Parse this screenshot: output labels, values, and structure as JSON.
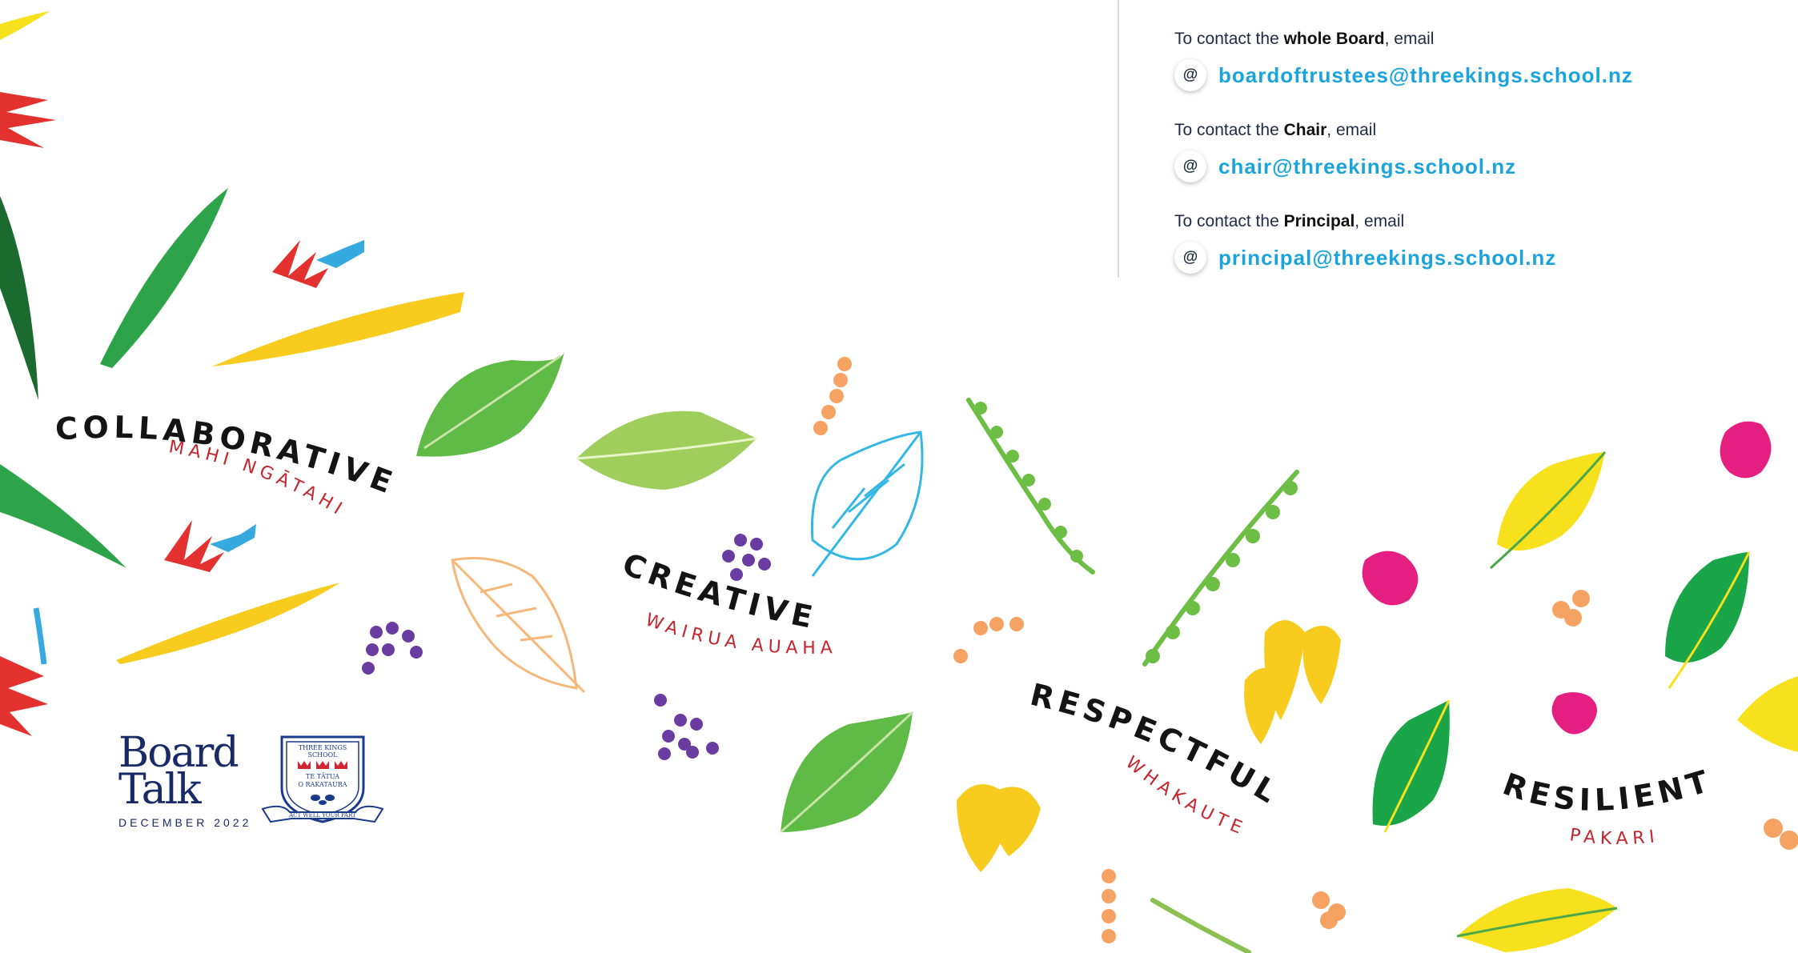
{
  "contact": {
    "blocks": [
      {
        "prefix": "To contact the ",
        "bold": "whole Board",
        "suffix": ", email",
        "email": "boardoftrustees@threekings.school.nz"
      },
      {
        "prefix": "To contact the ",
        "bold": "Chair",
        "suffix": ", email",
        "email": "chair@threekings.school.nz"
      },
      {
        "prefix": "To contact the ",
        "bold": "Principal",
        "suffix": ", email",
        "email": "principal@threekings.school.nz"
      }
    ],
    "at_symbol": "@"
  },
  "values": [
    {
      "word": "COLLABORATIVE",
      "maori": "MAHI NGĀTAHI"
    },
    {
      "word": "CREATIVE",
      "maori": "WAIRUA AUAHA"
    },
    {
      "word": "RESPECTFUL",
      "maori": "WHAKAUTE"
    },
    {
      "word": "RESILIENT",
      "maori": "PAKARI"
    }
  ],
  "brand": {
    "title_line1": "Board",
    "title_line2": "Talk",
    "date": "DECEMBER 2022"
  },
  "crest": {
    "line1": "THREE KINGS",
    "line2": "SCHOOL",
    "line3": "TE TĀTUA",
    "line4": "O RAKATAURA",
    "motto": "ACT WELL YOUR PART"
  },
  "colors": {
    "email_link": "#1ba4dc",
    "value_word": "#141414",
    "value_maori": "#c4252e",
    "brand_navy": "#1a2a66"
  }
}
